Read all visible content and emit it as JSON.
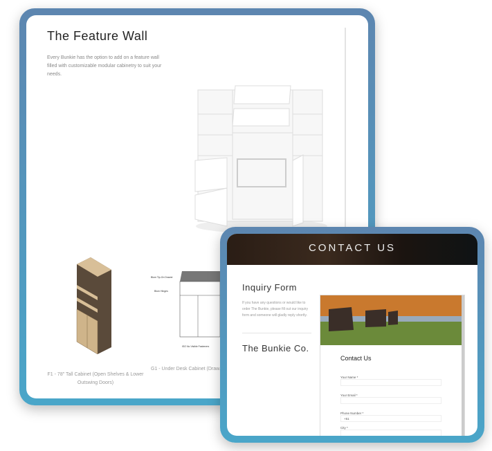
{
  "feature_page": {
    "title": "The Feature Wall",
    "description": "Every Bunkie has the option to add on a feature wall filled with customizable modular cabinetry to suit your needs.",
    "products": [
      {
        "caption": "F1 - 78\" Tall Cabinet (Open Shelves & Lower Outswing Doors)"
      },
      {
        "caption": "G1 - Under Desk Cabinet (Draw... Lower Outswing Doors)"
      }
    ]
  },
  "contact_page": {
    "banner_title": "CONTACT US",
    "inquiry_title": "Inquiry Form",
    "inquiry_text": "If you have any questions or would like to order The Bunkie, please fill out our inquiry form and someone will gladly reply shortly.",
    "company": "The Bunkie Co.",
    "form": {
      "title": "Contact Us",
      "fields": [
        {
          "label": "Your Name *",
          "value": ""
        },
        {
          "label": "Your Email *",
          "value": ""
        },
        {
          "label": "Phone Number *",
          "value": "+51"
        },
        {
          "label": "City *",
          "value": ""
        }
      ]
    }
  },
  "colors": {
    "frame_top": "#5d86b0",
    "frame_bottom": "#4aa6c9"
  }
}
